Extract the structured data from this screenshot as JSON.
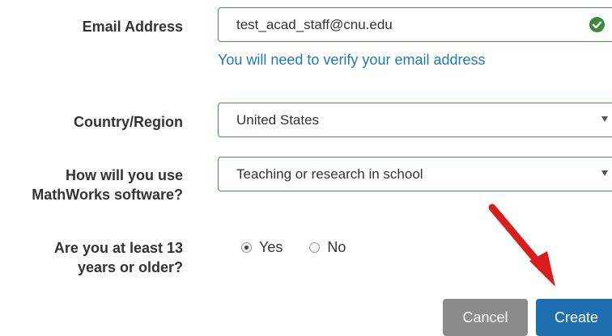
{
  "form": {
    "email": {
      "label": "Email Address",
      "value": "test_acad_staff@cnu.edu",
      "hint": "You will need to verify your email address",
      "status_icon": "check-circle-icon",
      "valid_color": "#3c8a3c"
    },
    "country": {
      "label": "Country/Region",
      "selected": "United States"
    },
    "usage": {
      "label_lines": [
        "How will you use",
        "MathWorks software?"
      ],
      "selected": "Teaching or research in school"
    },
    "age": {
      "label_lines": [
        "Are you at least 13",
        "years or older?"
      ],
      "options": [
        "Yes",
        "No"
      ],
      "selected": "Yes"
    }
  },
  "actions": {
    "cancel_label": "Cancel",
    "create_label": "Create",
    "cancel_color": "#8b8b8b",
    "create_color": "#1f6fb0"
  },
  "annotation": {
    "arrow_icon": "red-arrow-pointing-to-create",
    "color": "#e02020"
  }
}
